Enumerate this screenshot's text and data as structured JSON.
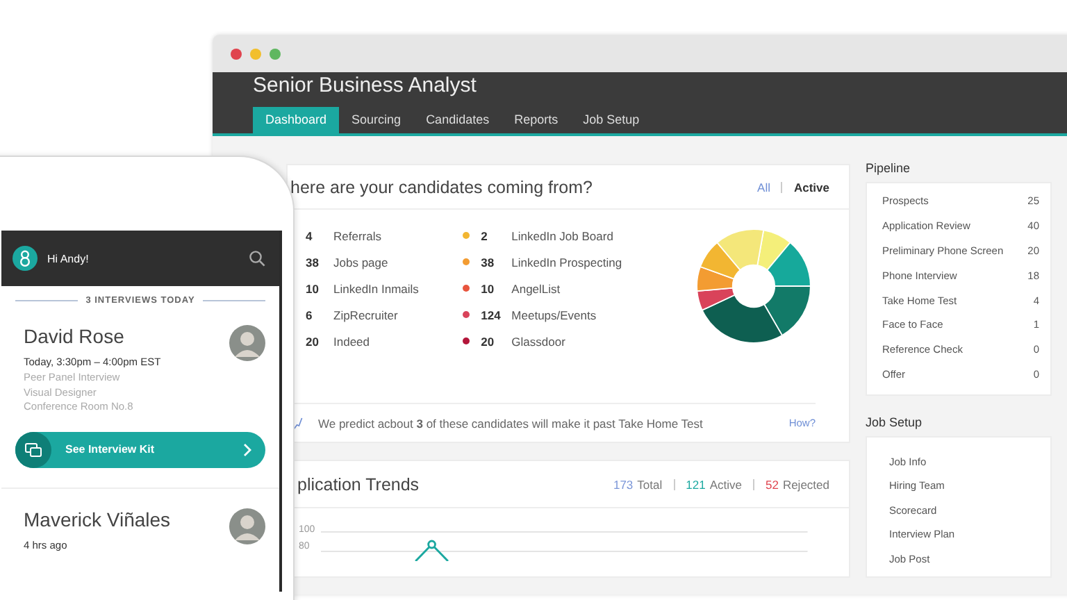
{
  "window": {
    "title": "Senior Business Analyst"
  },
  "tabs": [
    {
      "label": "Dashboard",
      "selected": true
    },
    {
      "label": "Sourcing",
      "selected": false
    },
    {
      "label": "Candidates",
      "selected": false
    },
    {
      "label": "Reports",
      "selected": false
    },
    {
      "label": "Job Setup",
      "selected": false
    }
  ],
  "sources_card": {
    "title": "here are your candidates coming from?",
    "filters": [
      {
        "label": "All",
        "selected": false
      },
      {
        "label": "Active",
        "selected": true
      }
    ],
    "sources_left": [
      {
        "count": "4",
        "label": "Referrals"
      },
      {
        "count": "38",
        "label": "Jobs page"
      },
      {
        "count": "10",
        "label": "LinkedIn Inmails"
      },
      {
        "count": "6",
        "label": "ZipRecruiter"
      },
      {
        "count": "20",
        "label": "Indeed"
      }
    ],
    "sources_right": [
      {
        "count": "2",
        "label": "LinkedIn Job Board",
        "color": "#f2b632"
      },
      {
        "count": "38",
        "label": "LinkedIn Prospecting",
        "color": "#f39c32"
      },
      {
        "count": "10",
        "label": "AngelList",
        "color": "#e8553e"
      },
      {
        "count": "124",
        "label": "Meetups/Events",
        "color": "#d9435a"
      },
      {
        "count": "20",
        "label": "Glassdoor",
        "color": "#b3163a"
      }
    ],
    "prediction": "We predict acbout **3** of these candidates will make it past Take Home Test",
    "link": "How?"
  },
  "trends_card": {
    "title": "plication Trends",
    "stats": [
      {
        "value": "173",
        "label": "Total",
        "color": "#7b96d8"
      },
      {
        "value": "121",
        "label": "Active",
        "color": "#1ba8a0"
      },
      {
        "value": "52",
        "label": "Rejected",
        "color": "#e0434e"
      }
    ],
    "y_ticks": [
      "100",
      "80"
    ]
  },
  "pipeline": {
    "title": "Pipeline",
    "stages": [
      {
        "label": "Prospects",
        "count": "25"
      },
      {
        "label": "Application Review",
        "count": "40"
      },
      {
        "label": "Preliminary Phone Screen",
        "count": "20"
      },
      {
        "label": "Phone Interview",
        "count": "18"
      },
      {
        "label": "Take Home Test",
        "count": "4"
      },
      {
        "label": "Face to Face",
        "count": "1"
      },
      {
        "label": "Reference Check",
        "count": "0"
      },
      {
        "label": "Offer",
        "count": "0"
      }
    ]
  },
  "job_setup": {
    "title": "Job Setup",
    "items": [
      "Job Info",
      "Hiring Team",
      "Scorecard",
      "Interview Plan",
      "Job Post"
    ]
  },
  "phone": {
    "greeting": "Hi Andy!",
    "section_title": "3 INTERVIEWS TODAY",
    "interviews": [
      {
        "name": "David Rose",
        "time": "Today, 3:30pm – 4:00pm EST",
        "details": [
          "Peer Panel Interview",
          "Visual Designer",
          "Conference Room No.8"
        ],
        "action": "See Interview Kit"
      },
      {
        "name": "Maverick Viñales",
        "time": "4 hrs ago"
      }
    ]
  }
}
